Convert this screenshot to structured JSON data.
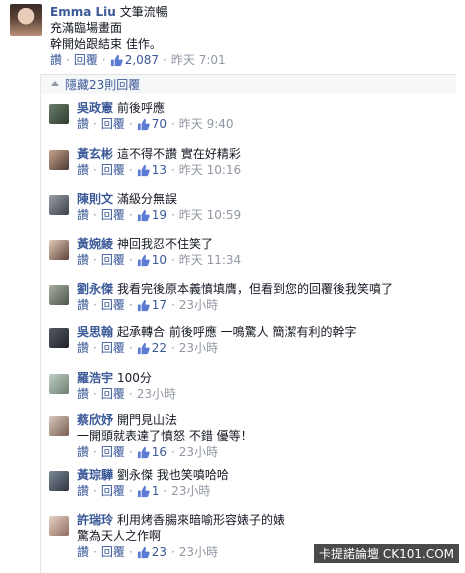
{
  "root": {
    "name": "Emma Liu",
    "text_lines": [
      "文筆流暢",
      "充滿臨場畫面",
      "幹開始跟結束 佳作。"
    ],
    "like_label": "讚",
    "reply_label": "回覆",
    "likes": "2,087",
    "time": "昨天 7:01"
  },
  "hidden_replies_label": "隱藏23則回覆",
  "replies": [
    {
      "name": "吳政憲",
      "lines": [
        "前後呼應"
      ],
      "likes": "70",
      "time": "昨天 9:40"
    },
    {
      "name": "黃玄彬",
      "lines": [
        "這不得不讚 實在好精彩"
      ],
      "likes": "13",
      "time": "昨天 10:16"
    },
    {
      "name": "陳則文",
      "lines": [
        "滿級分無誤"
      ],
      "likes": "19",
      "time": "昨天 10:59"
    },
    {
      "name": "黃婉綾",
      "lines": [
        "神回我忍不住笑了"
      ],
      "likes": "10",
      "time": "昨天 11:34"
    },
    {
      "name": "劉永傑",
      "lines": [
        "我看完後原本義憤填膺，但看到您的回覆後我笑噴了"
      ],
      "likes": "17",
      "time": "23小時"
    },
    {
      "name": "吳思翰",
      "lines": [
        "起承轉合 前後呼應 一鳴驚人 簡潔有利的幹字"
      ],
      "likes": "22",
      "time": "23小時"
    },
    {
      "name": "羅浩宇",
      "lines": [
        "100分"
      ],
      "likes": "",
      "time": "23小時"
    },
    {
      "name": "蔡欣妤",
      "lines": [
        "開門見山法",
        "一開頭就表達了憤怒 不錯 優等！"
      ],
      "likes": "16",
      "time": "23小時"
    },
    {
      "name": "黃琮驊",
      "lines": [
        "劉永傑 我也笑噴哈哈"
      ],
      "likes": "1",
      "time": "23小時"
    },
    {
      "name": "許瑞玲",
      "lines": [
        "利用烤香腸來暗喻形容婊子的婊",
        "驚為天人之作啊"
      ],
      "likes": "23",
      "time": "23小時"
    }
  ],
  "watermark": "卡提諾論壇 CK101.COM",
  "colors": {
    "link": "#3b5998",
    "meta": "#9197a3",
    "text": "#141823"
  },
  "icons": {
    "like": "thumbs-up-icon",
    "collapse": "caret-up-icon"
  }
}
